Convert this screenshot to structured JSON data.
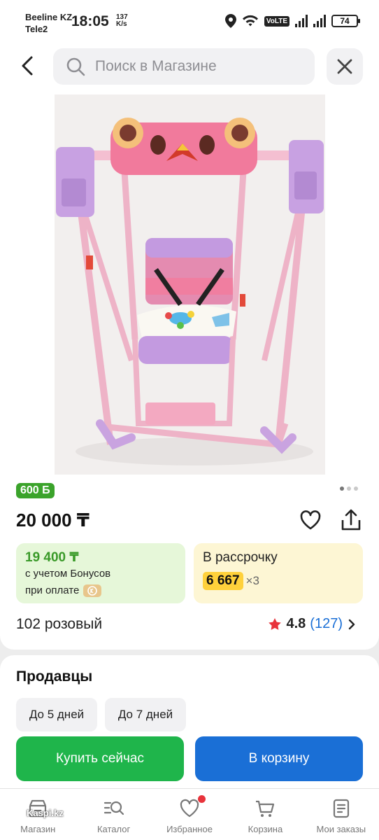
{
  "status_bar": {
    "carrier1": "Beeline KZ",
    "carrier2": "Tele2",
    "time": "18:05",
    "speed_value": "137",
    "speed_unit": "K/s",
    "volte": "VoLTE",
    "battery": "74"
  },
  "header": {
    "search_placeholder": "Поиск в Магазине"
  },
  "product": {
    "bonus_badge": "600 Б",
    "price": "20 000 ₸",
    "bonus_price": "19 400 ₸",
    "bonus_line1": "с учетом Бонусов",
    "bonus_line2": "при оплате",
    "installment_title": "В рассрочку",
    "installment_amount": "6 667",
    "installment_multiplier": "×3",
    "variant": "102 розовый",
    "rating": "4.8",
    "review_count": "(127)"
  },
  "sellers": {
    "title": "Продавцы",
    "chips": [
      "До 5 дней",
      "До 7 дней"
    ]
  },
  "actions": {
    "buy_now": "Купить сейчас",
    "add_to_cart": "В корзину"
  },
  "bottom_nav": {
    "items": [
      {
        "label": "Магазин",
        "icon": "shop-icon"
      },
      {
        "label": "Каталог",
        "icon": "catalog-search-icon"
      },
      {
        "label": "Избранное",
        "icon": "heart-icon"
      },
      {
        "label": "Корзина",
        "icon": "cart-icon"
      },
      {
        "label": "Мои заказы",
        "icon": "orders-icon"
      }
    ]
  },
  "watermark": "Kaspi.kz",
  "colors": {
    "green": "#1fb54b",
    "blue": "#1a6fd6",
    "bonus_green": "#3ba32b",
    "installment_yellow": "#ffd13b",
    "star_red": "#e8333b"
  }
}
